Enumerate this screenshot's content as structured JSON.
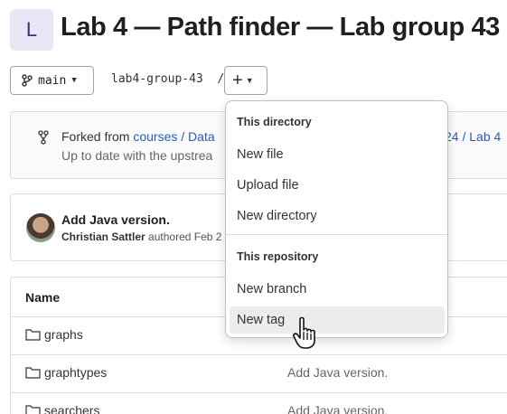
{
  "project": {
    "avatar_letter": "L",
    "title": "Lab 4 — Path finder — Lab group 43"
  },
  "toolbar": {
    "branch": "main",
    "path": "lab4-group-43",
    "path_sep": "/",
    "add_icon": "plus-icon"
  },
  "fork": {
    "prefix": "Forked from ",
    "link": "courses / Data",
    "link_tail": "24 / Lab 4",
    "status": "Up to date with the upstrea"
  },
  "commit": {
    "title": "Add Java version.",
    "author": "Christian Sattler",
    "meta": " authored Feb 2"
  },
  "files": {
    "header": "Name",
    "rows": [
      {
        "name": "graphs",
        "message": ""
      },
      {
        "name": "graphtypes",
        "message": "Add Java version."
      },
      {
        "name": "searchers",
        "message": "Add Java version."
      }
    ]
  },
  "dropdown": {
    "section1": "This directory",
    "new_file": "New file",
    "upload_file": "Upload file",
    "new_directory": "New directory",
    "section2": "This repository",
    "new_branch": "New branch",
    "new_tag": "New tag"
  }
}
